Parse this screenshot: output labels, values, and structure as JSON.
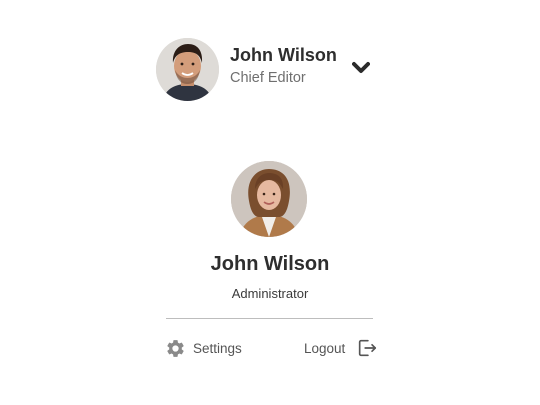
{
  "header": {
    "name": "John Wilson",
    "role": "Chief Editor",
    "avatar": "man-portrait-photo",
    "dropdown_icon": "chevron-down-icon"
  },
  "card": {
    "avatar": "woman-portrait-photo",
    "name": "John Wilson",
    "role": "Administrator",
    "settings_label": "Settings",
    "settings_icon": "gear-icon",
    "logout_label": "Logout",
    "logout_icon": "logout-icon"
  },
  "colors": {
    "text_primary": "#2e2e2e",
    "text_secondary": "#6f6f6f",
    "icon": "#8a8a8a",
    "divider": "#bdbdbd",
    "background": "#ffffff"
  }
}
